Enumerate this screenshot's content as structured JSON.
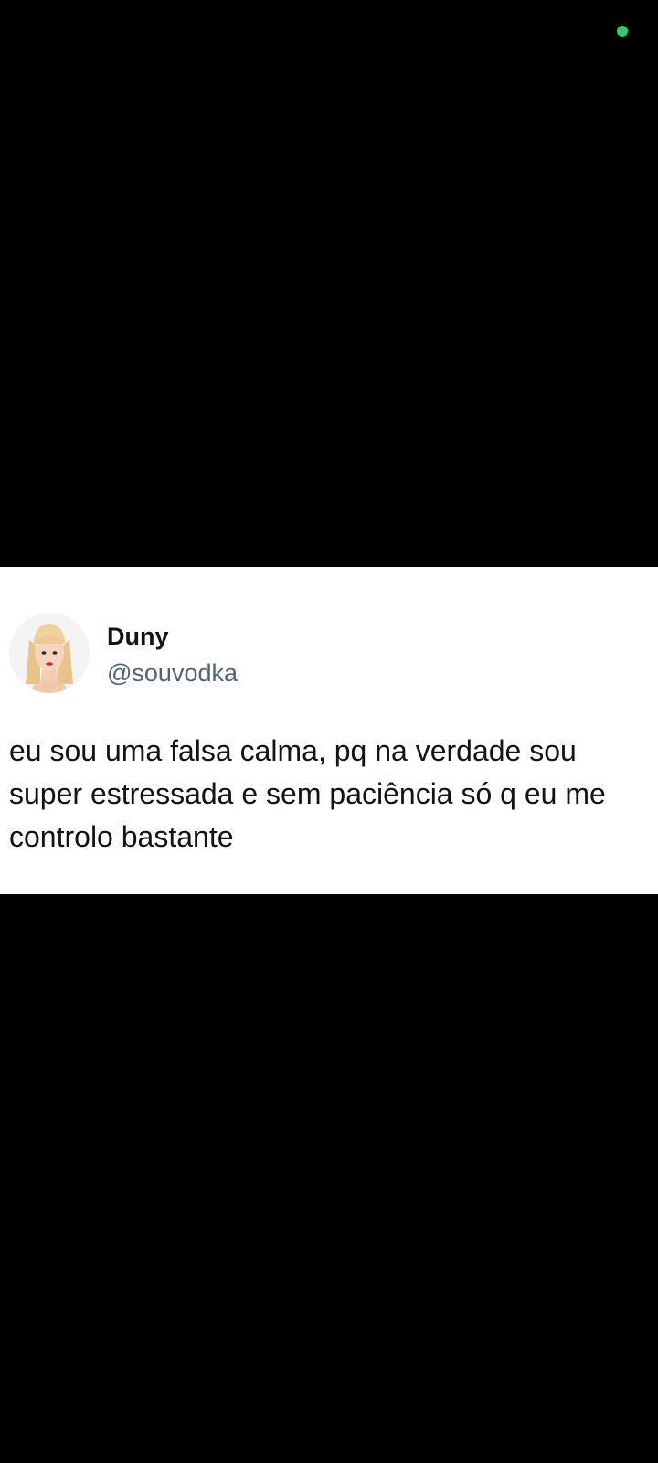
{
  "status_bar": {
    "indicator_color": "#2ecc71"
  },
  "tweet": {
    "author": {
      "display_name": "Duny",
      "handle": "@souvodka",
      "avatar_icon": "cartoon-blonde-girl-avatar"
    },
    "text": "eu sou uma falsa calma, pq na verdade sou super estressada e sem paciência só q eu me controlo bastante"
  }
}
